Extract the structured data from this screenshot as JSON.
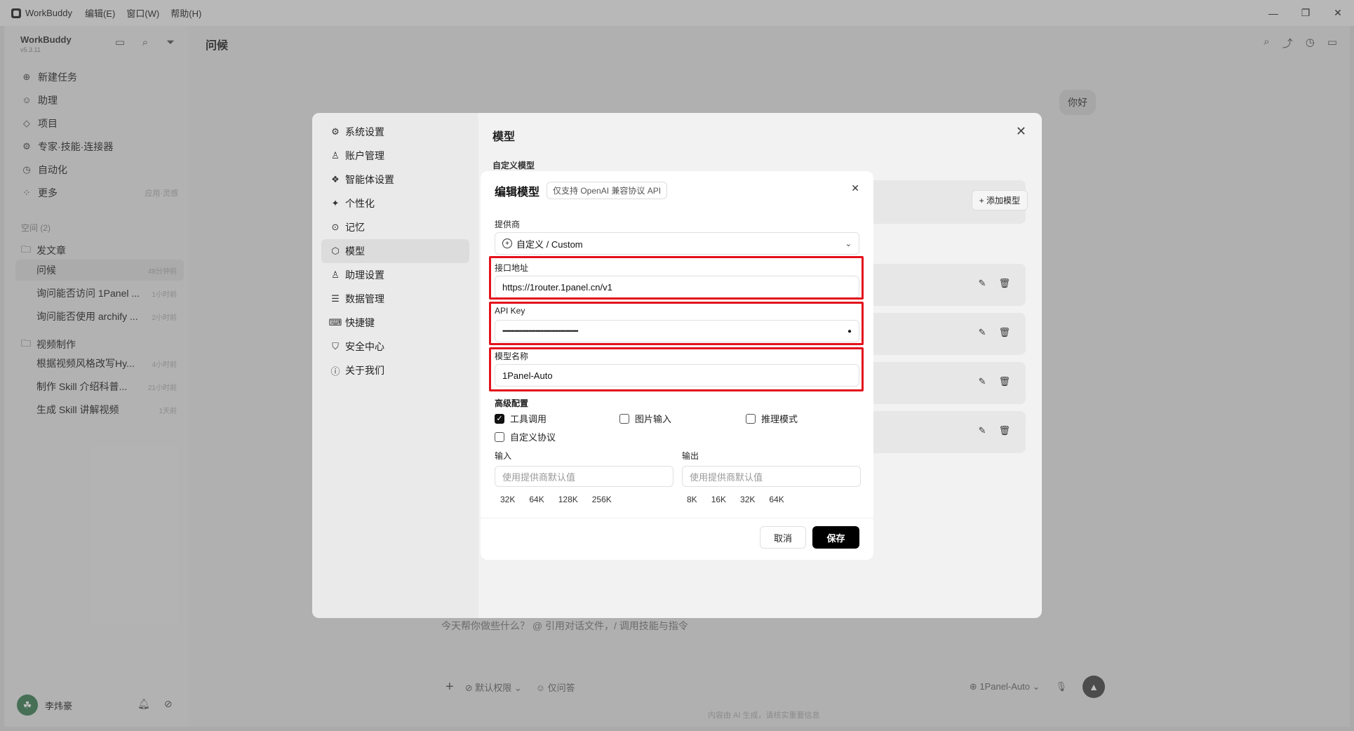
{
  "titlebar": {
    "app_name": "WorkBuddy",
    "menus": [
      "编辑(E)",
      "窗口(W)",
      "帮助(H)"
    ],
    "controls": [
      "—",
      "❐",
      "✕"
    ]
  },
  "sidebar": {
    "brand": "WorkBuddy",
    "version": "v5.3.11",
    "nav": [
      {
        "icon": "plus-circle-icon",
        "glyph": "⊕",
        "label": "新建任务",
        "hint": ""
      },
      {
        "icon": "assistant-icon",
        "glyph": "☺",
        "label": "助理",
        "hint": ""
      },
      {
        "icon": "project-icon",
        "glyph": "◇",
        "label": "项目",
        "hint": ""
      },
      {
        "icon": "expert-icon",
        "glyph": "⚙",
        "label": "专家·技能·连接器",
        "hint": ""
      },
      {
        "icon": "automation-icon",
        "glyph": "◷",
        "label": "自动化",
        "hint": ""
      },
      {
        "icon": "more-icon",
        "glyph": "⁘",
        "label": "更多",
        "hint": "应用·灵感"
      }
    ],
    "space_label": "空间 (2)",
    "folders": [
      {
        "name": "发文章",
        "threads": [
          {
            "title": "问候",
            "time": "48分钟前",
            "active": true
          },
          {
            "title": "询问能否访问 1Panel ...",
            "time": "1小时前",
            "active": false
          },
          {
            "title": "询问能否使用 archify ...",
            "time": "2小时前",
            "active": false
          }
        ]
      },
      {
        "name": "视频制作",
        "threads": [
          {
            "title": "根据视频风格改写Hy...",
            "time": "4小时前",
            "active": false
          },
          {
            "title": "制作 Skill 介绍科普...",
            "time": "21小时前",
            "active": false
          },
          {
            "title": "生成 Skill 讲解视频",
            "time": "1天前",
            "active": false
          }
        ]
      }
    ],
    "user_name": "李炜豪"
  },
  "main": {
    "title": "问候",
    "bubble": "你好",
    "composer_placeholder": "今天帮你做些什么？ @ 引用对话文件，/ 调用技能与指令",
    "permission": "默认权限",
    "mode": "仅问答",
    "model": "1Panel-Auto",
    "footnote": "内容由 AI 生成，请核实重要信息"
  },
  "settings": {
    "nav": [
      {
        "icon": "gear-icon",
        "glyph": "⚙",
        "label": "系统设置",
        "active": false
      },
      {
        "icon": "user-icon",
        "glyph": "♙",
        "label": "账户管理",
        "active": false
      },
      {
        "icon": "agent-icon",
        "glyph": "❖",
        "label": "智能体设置",
        "active": false
      },
      {
        "icon": "sparkle-icon",
        "glyph": "✦",
        "label": "个性化",
        "active": false
      },
      {
        "icon": "pin-icon",
        "glyph": "⊙",
        "label": "记忆",
        "active": false
      },
      {
        "icon": "cube-icon",
        "glyph": "⬡",
        "label": "模型",
        "active": true
      },
      {
        "icon": "assistant-settings-icon",
        "glyph": "♙",
        "label": "助理设置",
        "active": false
      },
      {
        "icon": "database-icon",
        "glyph": "☰",
        "label": "数据管理",
        "active": false
      },
      {
        "icon": "keyboard-icon",
        "glyph": "⌨",
        "label": "快捷键",
        "active": false
      },
      {
        "icon": "shield-icon",
        "glyph": "⛉",
        "label": "安全中心",
        "active": false
      },
      {
        "icon": "info-icon",
        "glyph": "ⓘ",
        "label": "关于我们",
        "active": false
      }
    ],
    "title": "模型",
    "subtitle": "自定义模型",
    "add_model": "+ 添加模型"
  },
  "edit_model": {
    "title": "编辑模型",
    "badge": "仅支持 OpenAI 兼容协议 API",
    "provider_label": "提供商",
    "provider_value": "自定义 / Custom",
    "endpoint_label": "接口地址",
    "endpoint_value": "https://1router.1panel.cn/v1",
    "apikey_label": "API Key",
    "apikey_value": "••••••••••••••••••••••••••••••••••••••••••••••••••",
    "model_name_label": "模型名称",
    "model_name_value": "1Panel-Auto",
    "advanced_label": "高级配置",
    "options": [
      {
        "label": "工具调用",
        "checked": true
      },
      {
        "label": "图片输入",
        "checked": false
      },
      {
        "label": "推理模式",
        "checked": false
      },
      {
        "label": "自定义协议",
        "checked": false
      }
    ],
    "input_label": "输入",
    "output_label": "输出",
    "input_placeholder": "使用提供商默认值",
    "output_placeholder": "使用提供商默认值",
    "input_presets": [
      "32K",
      "64K",
      "128K",
      "256K"
    ],
    "output_presets": [
      "8K",
      "16K",
      "32K",
      "64K"
    ],
    "cancel": "取消",
    "save": "保存"
  }
}
